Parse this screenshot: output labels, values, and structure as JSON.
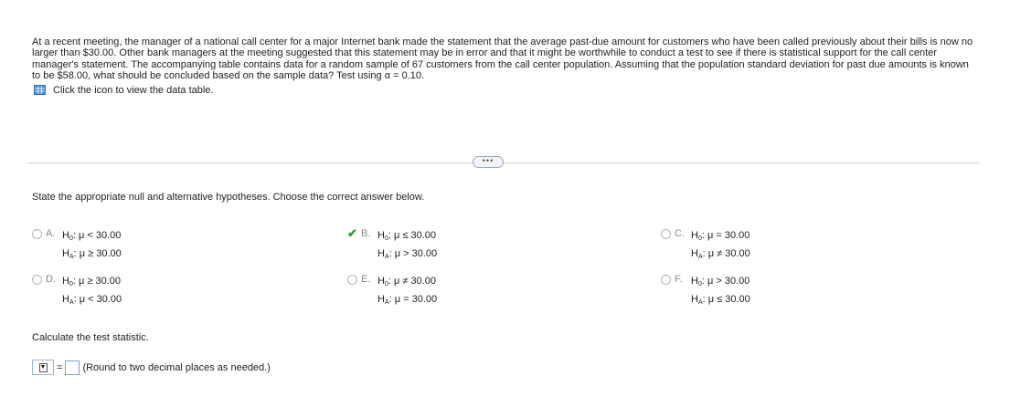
{
  "problem": {
    "text": "At a recent meeting, the manager of a national call center for a major Internet bank made the statement that the average past-due amount for customers who have been called previously about their bills is now no larger than $30.00. Other bank managers at the meeting suggested that this statement may be in error and that it might be worthwhile to conduct a test to see if there is statistical support for the call center manager's statement. The accompanying table contains data for a random sample of 67 customers from the call center population. Assuming that the population standard deviation for past due amounts is known to be $58.00, what should be concluded based on the sample data? Test using α = 0.10.",
    "data_link": "Click the icon to view the data table."
  },
  "more_button": "•••",
  "question1": "State the appropriate null and alternative hypotheses. Choose the correct answer below.",
  "options": [
    {
      "letter": "A.",
      "h0_label": "H",
      "h0_sub": "0",
      "h0": ": μ < 30.00",
      "ha_label": "H",
      "ha_sub": "A",
      "ha": ": μ ≥ 30.00",
      "selected": false
    },
    {
      "letter": "B.",
      "h0_label": "H",
      "h0_sub": "0",
      "h0": ": μ ≤ 30.00",
      "ha_label": "H",
      "ha_sub": "A",
      "ha": ": μ > 30.00",
      "selected": true
    },
    {
      "letter": "C.",
      "h0_label": "H",
      "h0_sub": "0",
      "h0": ": μ = 30.00",
      "ha_label": "H",
      "ha_sub": "A",
      "ha": ": μ ≠ 30.00",
      "selected": false
    },
    {
      "letter": "D.",
      "h0_label": "H",
      "h0_sub": "0",
      "h0": ": μ ≥ 30.00",
      "ha_label": "H",
      "ha_sub": "A",
      "ha": ": μ < 30.00",
      "selected": false
    },
    {
      "letter": "E.",
      "h0_label": "H",
      "h0_sub": "0",
      "h0": ": μ ≠ 30.00",
      "ha_label": "H",
      "ha_sub": "A",
      "ha": ": μ = 30.00",
      "selected": false
    },
    {
      "letter": "F.",
      "h0_label": "H",
      "h0_sub": "0",
      "h0": ": μ > 30.00",
      "ha_label": "H",
      "ha_sub": "A",
      "ha": ": μ ≤ 30.00",
      "selected": false
    }
  ],
  "question2": "Calculate the test statistic.",
  "answer": {
    "select_arrow": "▼",
    "equals": "=",
    "value": "",
    "hint": "(Round to two decimal places as needed.)"
  },
  "colors": {
    "check": "#2e9a3a",
    "icon": "#4a8ed6",
    "divider": "#d3d3d3"
  }
}
